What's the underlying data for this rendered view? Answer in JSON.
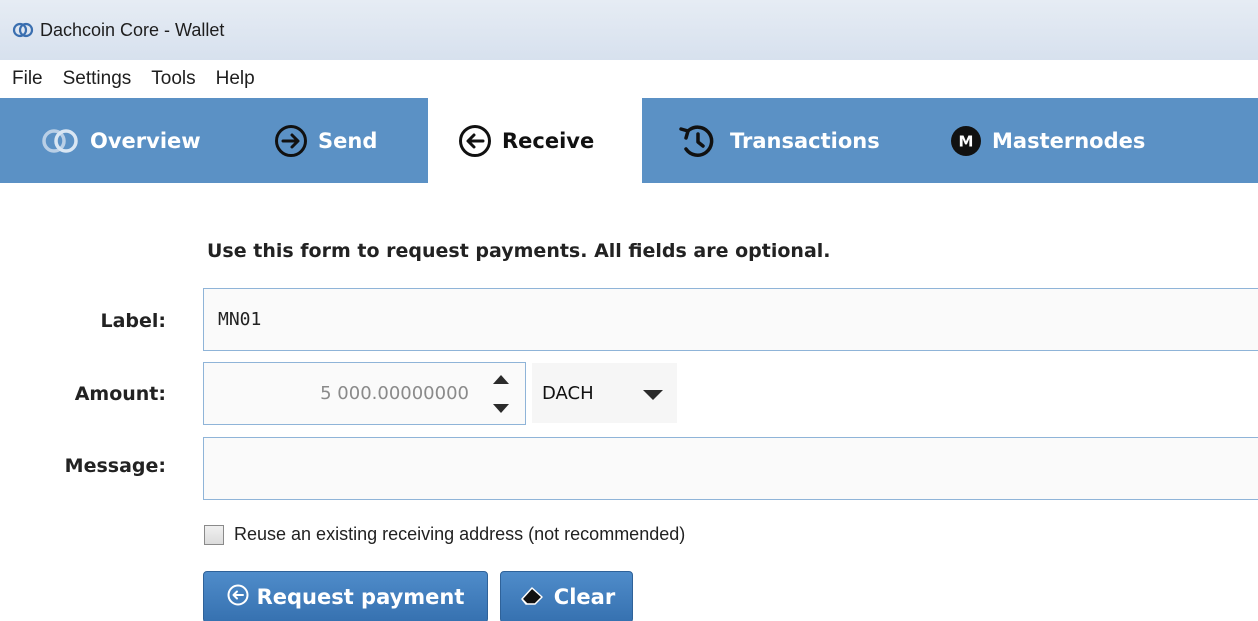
{
  "window": {
    "title": "Dachcoin Core - Wallet",
    "icon": "dachcoin-logo-icon"
  },
  "menu": {
    "items": [
      {
        "label": "File"
      },
      {
        "label": "Settings"
      },
      {
        "label": "Tools"
      },
      {
        "label": "Help"
      }
    ]
  },
  "tabs": [
    {
      "label": "Overview",
      "icon": "dachcoin-logo-icon",
      "active": false
    },
    {
      "label": "Send",
      "icon": "arrow-right-circle-icon",
      "active": false
    },
    {
      "label": "Receive",
      "icon": "arrow-left-circle-icon",
      "active": true
    },
    {
      "label": "Transactions",
      "icon": "history-icon",
      "active": false
    },
    {
      "label": "Masternodes",
      "icon": "masternode-m-icon",
      "active": false
    }
  ],
  "form": {
    "intro": "Use this form to request payments. All fields are optional.",
    "label_caption": "Label:",
    "label_value": "MN01",
    "amount_caption": "Amount:",
    "amount_value": "5 000.00000000",
    "unit": "DACH",
    "message_caption": "Message:",
    "message_value": "",
    "reuse_label": "Reuse an existing receiving address (not recommended)",
    "reuse_checked": false
  },
  "buttons": {
    "request_label": "Request payment",
    "clear_label": "Clear"
  },
  "colors": {
    "tabbar": "#5b91c5",
    "button": "#3f7dbd",
    "field_border": "#8fb4d8"
  }
}
